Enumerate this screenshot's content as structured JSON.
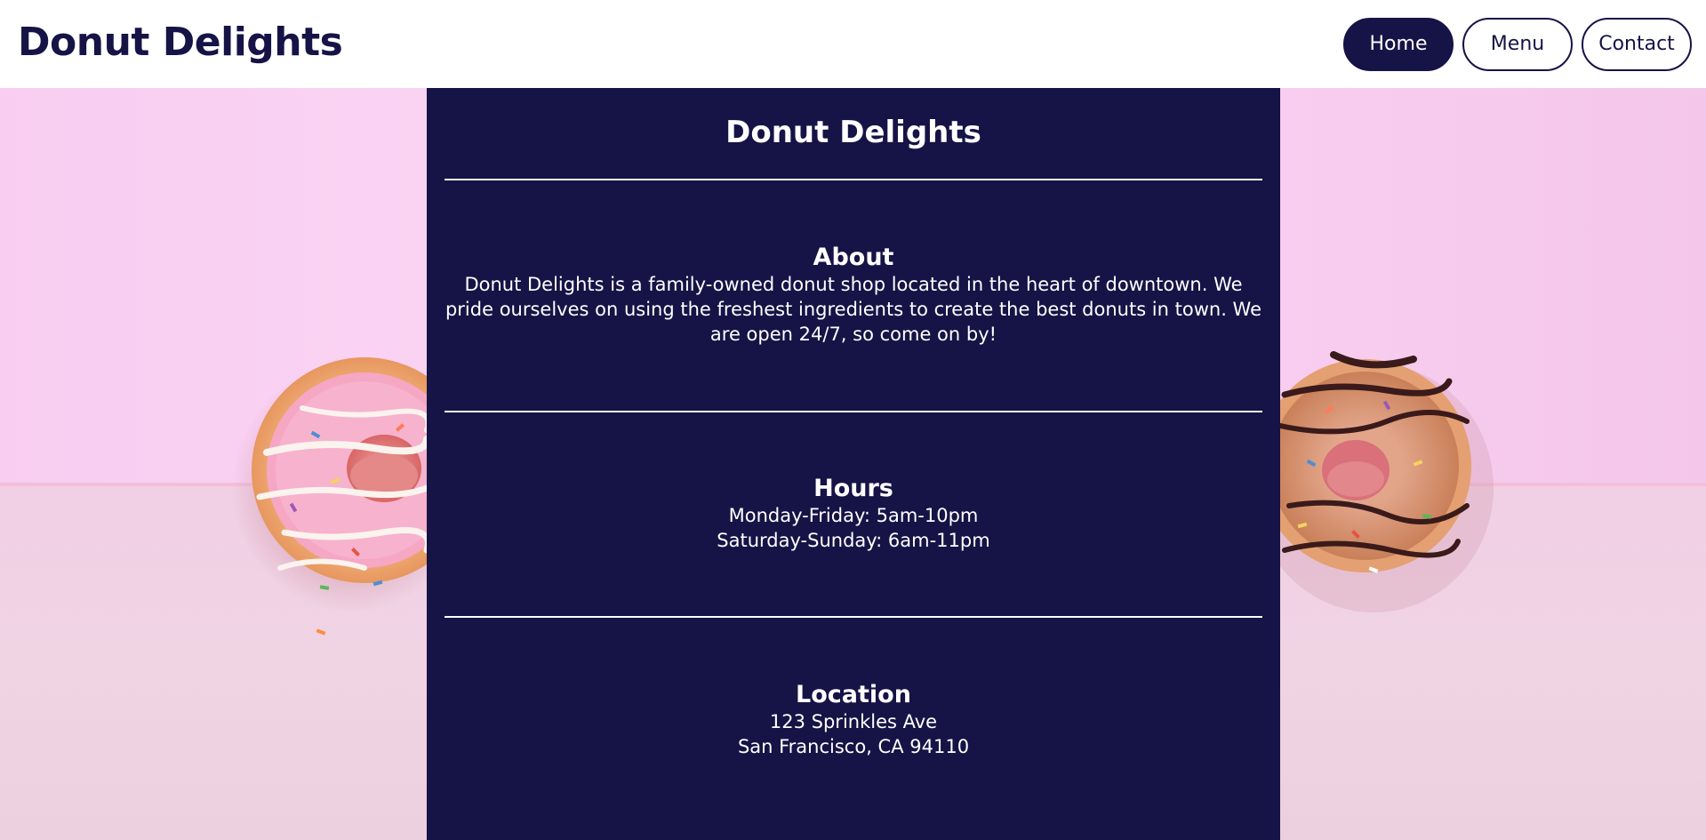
{
  "header": {
    "brand": "Donut Delights",
    "nav": [
      {
        "label": "Home",
        "active": true
      },
      {
        "label": "Menu",
        "active": false
      },
      {
        "label": "Contact",
        "active": false
      }
    ]
  },
  "panel": {
    "title": "Donut Delights",
    "about": {
      "heading": "About",
      "text": "Donut Delights is a family-owned donut shop located in the heart of downtown. We pride ourselves on using the freshest ingredients to create the best donuts in town. We are open 24/7, so come on by!"
    },
    "hours": {
      "heading": "Hours",
      "weekday": "Monday-Friday: 5am-10pm",
      "weekend": "Saturday-Sunday: 6am-11pm"
    },
    "location": {
      "heading": "Location",
      "street": "123 Sprinkles Ave",
      "city": "San Francisco, CA 94110"
    }
  },
  "colors": {
    "primary": "#161346",
    "background": "#ffffff",
    "pink_backdrop": "#fad3f3"
  },
  "images": {
    "left": "pink-sprinkle-donut-photo",
    "right": "chocolate-drizzle-donut-photo"
  }
}
